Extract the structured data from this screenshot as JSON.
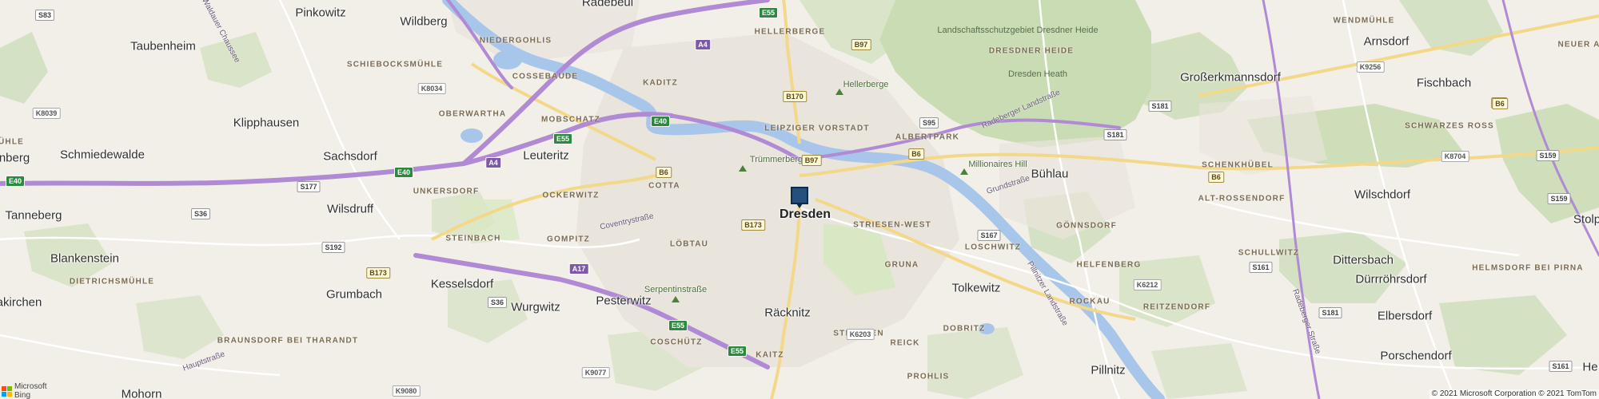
{
  "map": {
    "colors": {
      "land": "#f2efe9",
      "forest": "#c9dcb4",
      "park": "#d8e8c4",
      "urban": "#e9e4dc",
      "water": "#a8c6ea",
      "motorway": "#b08ad4",
      "primary": "#f4d88a",
      "secondary": "#ffffff",
      "marker": "#25507e"
    },
    "marker_icon": "location-square-marker-icon",
    "towns": [
      {
        "name": "Radebeul"
      },
      {
        "name": "Pinkowitz"
      },
      {
        "name": "Wildberg"
      },
      {
        "name": "Taubenheim"
      },
      {
        "name": "Klipphausen"
      },
      {
        "name": "Schmiedewalde"
      },
      {
        "name": "Sachsdorf"
      },
      {
        "name": "Leuteritz"
      },
      {
        "name": "nberg"
      },
      {
        "name": "Tanneberg"
      },
      {
        "name": "Wilsdruff"
      },
      {
        "name": "Blankenstein"
      },
      {
        "name": "Kesselsdorf"
      },
      {
        "name": "Grumbach"
      },
      {
        "name": "akirchen"
      },
      {
        "name": "Wurgwitz"
      },
      {
        "name": "Pesterwitz"
      },
      {
        "name": "Räcknitz"
      },
      {
        "name": "Mohorn"
      },
      {
        "name": "Tolkewitz"
      },
      {
        "name": "Bühlau"
      },
      {
        "name": "Großerkmannsdorf"
      },
      {
        "name": "Arnsdorf"
      },
      {
        "name": "Fischbach"
      },
      {
        "name": "Wilschdorf"
      },
      {
        "name": "Dittersbach"
      },
      {
        "name": "Dürrröhrsdorf"
      },
      {
        "name": "Elbersdorf"
      },
      {
        "name": "Porschendorf"
      },
      {
        "name": "Pillnitz"
      },
      {
        "name": "Stolp"
      },
      {
        "name": "He"
      }
    ],
    "city": {
      "name": "Dresden"
    },
    "districts": [
      {
        "name": "HELLERBERGE"
      },
      {
        "name": "NIEDERGOHLIS"
      },
      {
        "name": "SCHIEBOCKSMÜHLE"
      },
      {
        "name": "COSSEBAUDE"
      },
      {
        "name": "KADITZ"
      },
      {
        "name": "OBERWARTHA"
      },
      {
        "name": "MOBSCHATZ"
      },
      {
        "name": "LEIPZIGER VORSTADT"
      },
      {
        "name": "ALBERTPARK"
      },
      {
        "name": "DRESDNER HEIDE"
      },
      {
        "name": "WENDMÜHLE"
      },
      {
        "name": "NEUER A"
      },
      {
        "name": "SCHWARZES ROSS"
      },
      {
        "name": "SCHENKHÜBEL"
      },
      {
        "name": "ALT-ROSSENDORF"
      },
      {
        "name": "UNKERSDORF"
      },
      {
        "name": "OCKERWITZ"
      },
      {
        "name": "COTTA"
      },
      {
        "name": "STRIESEN-WEST"
      },
      {
        "name": "GÖNNSDORF"
      },
      {
        "name": "LOSCHWITZ"
      },
      {
        "name": "GOMPITZ"
      },
      {
        "name": "STEINBACH"
      },
      {
        "name": "LÖBTAU"
      },
      {
        "name": "GRUNA"
      },
      {
        "name": "HELFENBERG"
      },
      {
        "name": "SCHULLWITZ"
      },
      {
        "name": "HELMSDORF BEI PIRNA"
      },
      {
        "name": "DIETRICHSMÜHLE"
      },
      {
        "name": "STREHLEN"
      },
      {
        "name": "ROCKAU"
      },
      {
        "name": "REITZENDORF"
      },
      {
        "name": "BRAUNSDORF BEI THARANDT"
      },
      {
        "name": "DOBRITZ"
      },
      {
        "name": "COSCHÜTZ"
      },
      {
        "name": "KAITZ"
      },
      {
        "name": "REICK"
      },
      {
        "name": "PROHLIS"
      },
      {
        "name": "ÜHLE"
      }
    ],
    "pois": [
      {
        "name": "Hellerberge"
      },
      {
        "name": "Trümmerberg"
      },
      {
        "name": "Millionaires Hill"
      },
      {
        "name": "Serpentinstraße"
      }
    ],
    "forest_labels": [
      {
        "name": "Landschaftsschutzgebiet Dresdner Heide"
      },
      {
        "name": "Dresden Heath"
      }
    ],
    "streets": [
      {
        "name": "Radeberger Landstraße"
      },
      {
        "name": "Grundstraße"
      },
      {
        "name": "Coventrystraße"
      },
      {
        "name": "Pillnitzer Landstraße"
      },
      {
        "name": "Hauptstraße"
      },
      {
        "name": "Radeberger Straße"
      },
      {
        "name": "Waldauer Chaussee"
      }
    ],
    "shields": [
      {
        "label": "S83",
        "type": "s"
      },
      {
        "label": "E55",
        "type": "e"
      },
      {
        "label": "A4",
        "type": "a"
      },
      {
        "label": "B97",
        "type": "b"
      },
      {
        "label": "K8034",
        "type": "k"
      },
      {
        "label": "K8039",
        "type": "k"
      },
      {
        "label": "B170",
        "type": "b"
      },
      {
        "label": "E40",
        "type": "e"
      },
      {
        "label": "E55",
        "type": "e"
      },
      {
        "label": "S95",
        "type": "s"
      },
      {
        "label": "K9256",
        "type": "k"
      },
      {
        "label": "S181",
        "type": "s"
      },
      {
        "label": "B6",
        "type": "b"
      },
      {
        "label": "S181",
        "type": "s"
      },
      {
        "label": "B6",
        "type": "b"
      },
      {
        "label": "B97",
        "type": "b"
      },
      {
        "label": "B6",
        "type": "b"
      },
      {
        "label": "A4",
        "type": "a"
      },
      {
        "label": "E40",
        "type": "e"
      },
      {
        "label": "S177",
        "type": "s"
      },
      {
        "label": "E40",
        "type": "e"
      },
      {
        "label": "B6",
        "type": "b"
      },
      {
        "label": "K8704",
        "type": "k"
      },
      {
        "label": "S159",
        "type": "s"
      },
      {
        "label": "S159",
        "type": "s"
      },
      {
        "label": "S36",
        "type": "s"
      },
      {
        "label": "B173",
        "type": "b"
      },
      {
        "label": "S167",
        "type": "s"
      },
      {
        "label": "S192",
        "type": "s"
      },
      {
        "label": "A17",
        "type": "a"
      },
      {
        "label": "B173",
        "type": "b"
      },
      {
        "label": "K6212",
        "type": "k"
      },
      {
        "label": "S161",
        "type": "s"
      },
      {
        "label": "S36",
        "type": "s"
      },
      {
        "label": "E55",
        "type": "e"
      },
      {
        "label": "K6203",
        "type": "k"
      },
      {
        "label": "E55",
        "type": "e"
      },
      {
        "label": "K9077",
        "type": "k"
      },
      {
        "label": "S161",
        "type": "s"
      },
      {
        "label": "K9080",
        "type": "k"
      },
      {
        "label": "B6",
        "type": "b"
      },
      {
        "label": "S181",
        "type": "s"
      }
    ],
    "attribution": {
      "logo_line1": "Microsoft",
      "logo_line2": "Bing",
      "copyright": "© 2021 Microsoft Corporation © 2021 TomTom"
    }
  }
}
